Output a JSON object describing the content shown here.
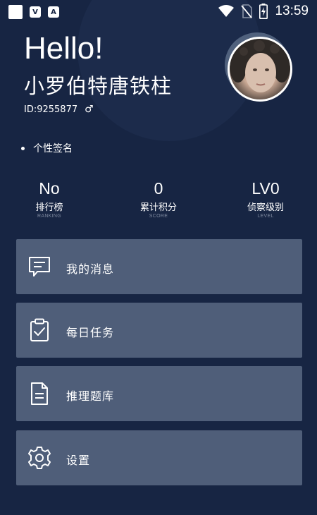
{
  "status_bar": {
    "time": "13:59",
    "left_icons": [
      "app-square-icon",
      "shield-badge-icon",
      "a-badge-icon"
    ],
    "shield_badge_letter": "V",
    "a_badge_letter": "A",
    "right_icons": [
      "wifi-icon",
      "no-sim-icon",
      "battery-charging-icon"
    ]
  },
  "profile": {
    "greeting": "Hello!",
    "name": "小罗伯特唐铁柱",
    "id_text": "ID:9255877",
    "gender_symbol": "♂",
    "signature": "个性签名"
  },
  "stats": [
    {
      "value": "No",
      "label": "排行榜",
      "sub": "RANKING"
    },
    {
      "value": "0",
      "label": "累计积分",
      "sub": "SCORE"
    },
    {
      "value": "LV0",
      "label": "侦察级别",
      "sub": "LEVEL"
    }
  ],
  "menu": [
    {
      "label": "我的消息",
      "icon": "message-icon"
    },
    {
      "label": "每日任务",
      "icon": "clipboard-check-icon"
    },
    {
      "label": "推理题库",
      "icon": "document-icon"
    },
    {
      "label": "设置",
      "icon": "gear-icon"
    }
  ],
  "colors": {
    "background": "#172543",
    "card": "#4f5e79",
    "text": "#ffffff",
    "subtext": "#7d889e"
  }
}
